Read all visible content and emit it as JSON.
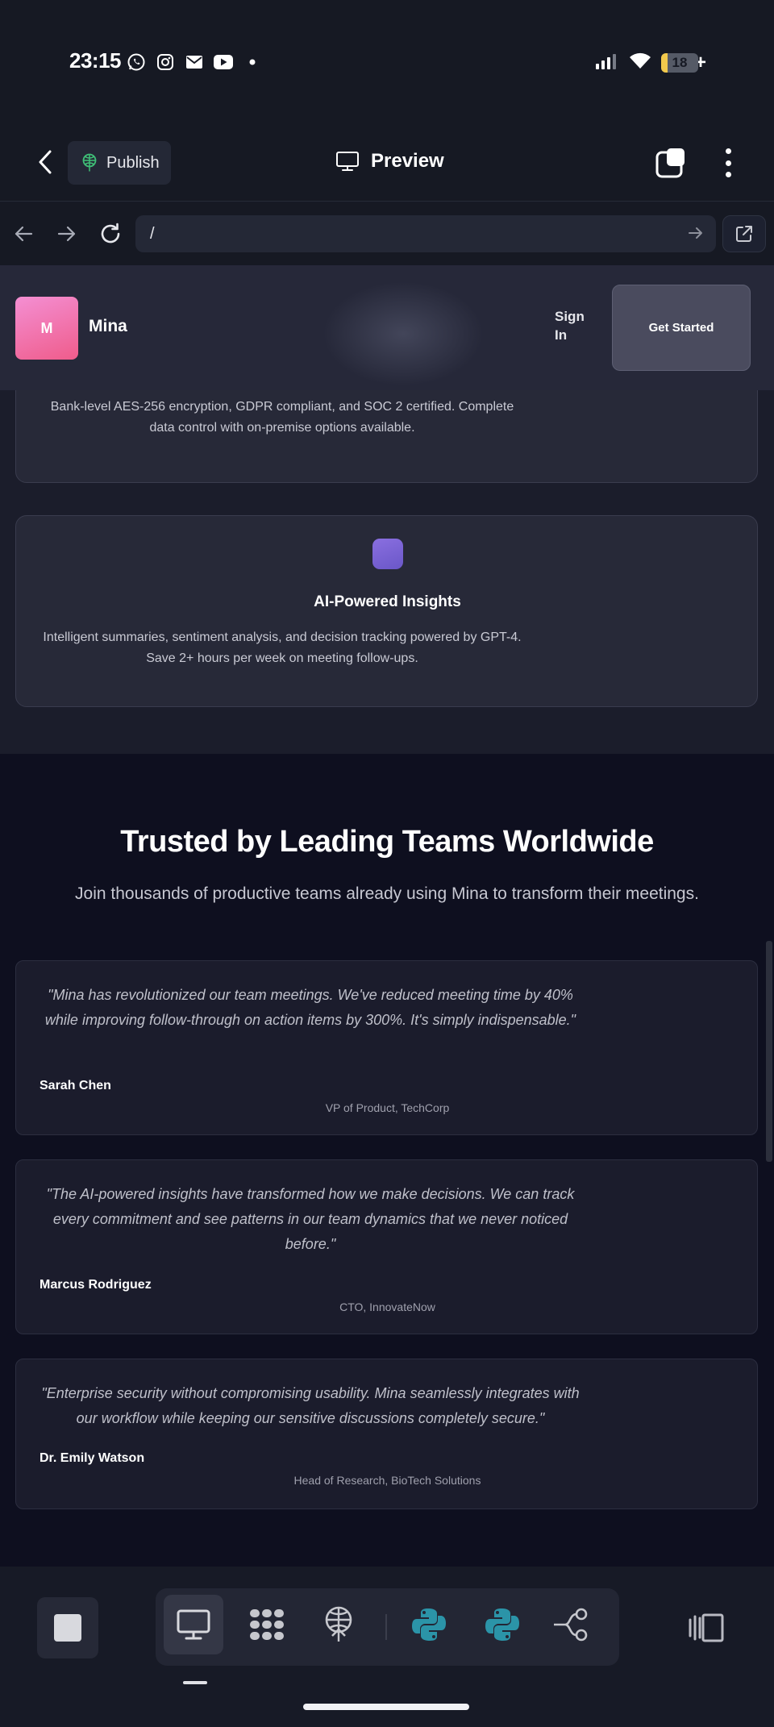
{
  "status_bar": {
    "time": "23:15",
    "notification_icons": [
      "whatsapp-icon",
      "instagram-icon",
      "mail-icon",
      "youtube-icon",
      "dot-icon"
    ],
    "battery_level": "18",
    "battery_suffix": "+"
  },
  "app_toolbar": {
    "publish_label": "Publish",
    "preview_label": "Preview"
  },
  "url_bar": {
    "url": "/"
  },
  "site": {
    "nav": {
      "logo_letter": "M",
      "brand": "Mina",
      "sign_in": "Sign In",
      "get_started": "Get Started"
    },
    "security_card": {
      "description": "Bank-level AES-256 encryption, GDPR compliant, and SOC 2 certified. Complete data control with on-premise options available."
    },
    "ai_card": {
      "title": "AI-Powered Insights",
      "description": "Intelligent summaries, sentiment analysis, and decision tracking powered by GPT-4. Save 2+ hours per week on meeting follow-ups."
    },
    "testimonials": {
      "title": "Trusted by Leading Teams Worldwide",
      "subtitle": "Join thousands of productive teams already using Mina to transform their meetings.",
      "items": [
        {
          "quote": "\"Mina has revolutionized our team meetings. We've reduced meeting time by 40% while improving follow-through on action items by 300%. It's simply indispensable.\"",
          "name": "Sarah Chen",
          "role": "VP of Product, TechCorp"
        },
        {
          "quote": "\"The AI-powered insights have transformed how we make decisions. We can track every commitment and see patterns in our team dynamics that we never noticed before.\"",
          "name": "Marcus Rodriguez",
          "role": "CTO, InnovateNow"
        },
        {
          "quote": "\"Enterprise security without compromising usability. Mina seamlessly integrates with our workflow while keeping our sensitive discussions completely secure.\"",
          "name": "Dr. Emily Watson",
          "role": "Head of Research, BioTech Solutions"
        }
      ]
    }
  },
  "dock": {
    "tools": [
      "preview-tool",
      "agents-tool",
      "publish-tool",
      "python-tool",
      "python-tool",
      "workflow-tool"
    ],
    "active_tool": "preview-tool"
  },
  "colors": {
    "accent_python": "#2b94a8",
    "logo_gradient_start": "#f48fd3",
    "logo_gradient_end": "#ef5c8b",
    "card_icon": "#7a63d6"
  }
}
